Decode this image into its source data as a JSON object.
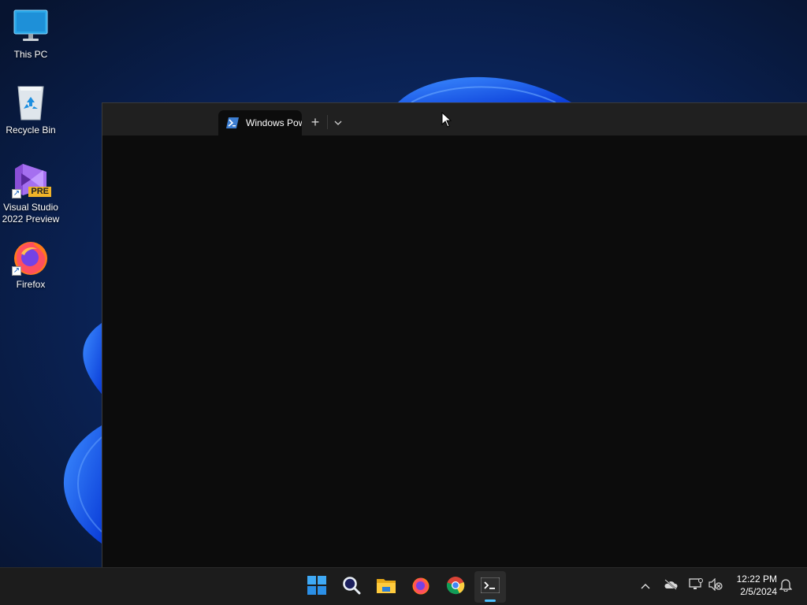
{
  "colors": {
    "wallpaper_dark": "#08183a",
    "wallpaper_bloom": "#1a5cf0",
    "terminal_bg": "#0c0c0c",
    "titlebar_bg": "#202020",
    "taskbar_bg": "#1c1c1c",
    "accent": "#4cc2ff"
  },
  "desktop": {
    "icons": [
      {
        "label": "This PC",
        "icon": "monitor-icon"
      },
      {
        "label": "Recycle Bin",
        "icon": "recycle-bin-icon"
      },
      {
        "label": "Visual Studio 2022 Preview",
        "icon": "visual-studio-icon",
        "badge": "PRE",
        "shortcut": true
      },
      {
        "label": "Firefox",
        "icon": "firefox-icon",
        "shortcut": true
      }
    ]
  },
  "terminal": {
    "tab_title": "Windows PowerShell",
    "tab_icon": "powershell-icon",
    "new_tab_glyph": "+",
    "dropdown_icon": "chevron-down-icon"
  },
  "taskbar": {
    "apps": [
      {
        "name": "Start",
        "icon": "windows-logo-icon"
      },
      {
        "name": "Search",
        "icon": "search-icon"
      },
      {
        "name": "File Explorer",
        "icon": "folder-icon"
      },
      {
        "name": "Firefox",
        "icon": "firefox-icon"
      },
      {
        "name": "Google Chrome",
        "icon": "chrome-icon"
      },
      {
        "name": "Terminal",
        "icon": "terminal-icon",
        "active": true
      }
    ],
    "tray": {
      "icons": [
        "chevron-up-icon",
        "onedrive-icon",
        "network-icon",
        "volume-muted-icon",
        "notification-bell-icon"
      ],
      "time": "12:22 PM",
      "date": "2/5/2024"
    }
  }
}
